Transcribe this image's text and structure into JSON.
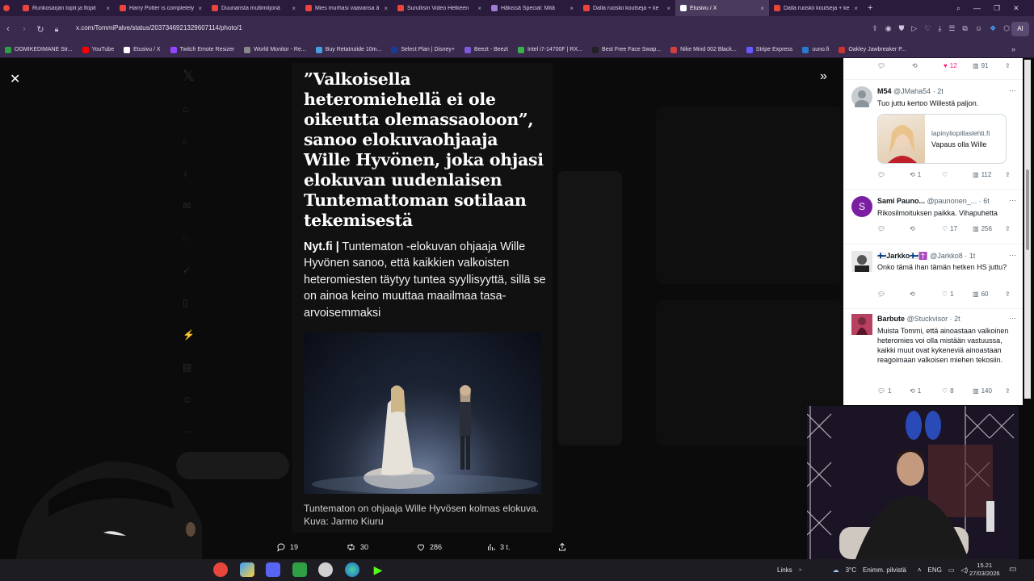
{
  "browser": {
    "tabs": [
      {
        "label": "Runkosarjan topit ja flopit",
        "color": "#e8453c",
        "active": false
      },
      {
        "label": "Harry Potter is completely",
        "color": "#e8453c",
        "active": false
      },
      {
        "label": "Duunarista multimiljonä",
        "color": "#e8453c",
        "active": false
      },
      {
        "label": "Mies murhasi vaavansa ä",
        "color": "#e8453c",
        "active": false
      },
      {
        "label": "Surullisin Video Hetkeen",
        "color": "#e8453c",
        "active": false
      },
      {
        "label": "Häkissä Special: Mitä",
        "color": "#a07ad8",
        "active": false
      },
      {
        "label": "Dalla ruoskii koutseja + ke",
        "color": "#e8453c",
        "active": false
      },
      {
        "label": "Etusivu / X",
        "color": "#ffffff",
        "active": true
      },
      {
        "label": "Dalla ruoskii koutseja + ke",
        "color": "#e8453c",
        "active": false
      }
    ],
    "new_tab": "+",
    "url": "x.com/TommiPalve/status/2037346921329607114/photo/1",
    "ai_label": "AI",
    "bookmarks": [
      {
        "label": "OGMIKEDIMANE Str...",
        "color": "#2ea043"
      },
      {
        "label": "YouTube",
        "color": "#ff0000"
      },
      {
        "label": "Etusivu / X",
        "color": "#ffffff"
      },
      {
        "label": "Twitch Emote Resizer",
        "color": "#9146ff"
      },
      {
        "label": "World Monitor - Re...",
        "color": "#888888"
      },
      {
        "label": "Buy Retatrutide 10m...",
        "color": "#46a0e0"
      },
      {
        "label": "Select Plan | Disney+",
        "color": "#1a3a9a"
      },
      {
        "label": "Beezt - Beezt",
        "color": "#7d5ad8"
      },
      {
        "label": "Intel i7-14700F | RX...",
        "color": "#3ab04a"
      },
      {
        "label": "Best Free Face Swap...",
        "color": "#222222"
      },
      {
        "label": "Nike Mind 002 Black...",
        "color": "#d04040"
      },
      {
        "label": "Stripe Express",
        "color": "#635bff"
      },
      {
        "label": "uuno.fi",
        "color": "#2a7ad0"
      },
      {
        "label": "Oakley Jawbreaker P...",
        "color": "#cc3333"
      }
    ]
  },
  "article": {
    "headline": "”Valkoisella heteromiehellä ei ole oikeutta olemassaoloon”, sanoo elokuvaohjaaja Wille Hyvönen, joka ohjasi elokuvan uudenlaisen Tuntemattoman sotilaan tekemisestä",
    "source": "Nyt.fi |",
    "lede": " Tuntematon -elokuvan ohjaaja Wille Hyvönen sanoo, että kaikkien valkoisten heteromiesten täytyy tuntea syyllisyyttä, sillä se on ainoa keino muuttaa maailmaa tasa-arvoisemmaksi",
    "caption": "Tuntematon on ohjaaja Wille Hyvösen kolmas elokuva. Kuva: Jarmo Kiuru"
  },
  "post_actions": {
    "replies": "19",
    "reposts": "30",
    "likes": "286",
    "views": "3 t."
  },
  "replies_panel": {
    "top_stats": {
      "likes": "12",
      "views": "91"
    },
    "replies": [
      {
        "name": "M54",
        "handle": "@JMaha54 · 2t",
        "text": "Tuo juttu kertoo Willestä paljon.",
        "card": {
          "domain": "lapinyliopillaslehti.fi",
          "title": "Vapaus olla Wille"
        },
        "stats": {
          "replies": "",
          "reposts": "1",
          "likes": "",
          "views": "112"
        },
        "avatar_color": "#9aa4ad"
      },
      {
        "name": "Sami Pauno...",
        "handle": "@paunonen_... · 6t",
        "text": "Rikosilmoituksen paikka. Vihapuhetta",
        "stats": {
          "replies": "",
          "reposts": "",
          "likes": "17",
          "views": "256"
        },
        "avatar_letter": "S",
        "avatar_color": "#7b1fa2"
      },
      {
        "name": "🇫🇮Jarkko🇫🇮✝️",
        "handle": "@Jarkko8 · 1t",
        "text": "Onko tämä ihan tämän hetken HS juttu?",
        "stats": {
          "replies": "",
          "reposts": "",
          "likes": "1",
          "views": "60"
        },
        "avatar_color": "#4a4a4a"
      },
      {
        "name": "Barbute",
        "handle": "@Stuckvisor · 2t",
        "text": "Muista Tommi, että ainoastaan valkoinen heteromies voi olla mistään vastuussa, kaikki muut ovat kykeneviä ainoastaan reagoimaan valkoisen miehen tekosiin.",
        "stats": {
          "replies": "1",
          "reposts": "1",
          "likes": "8",
          "views": "140"
        },
        "avatar_color": "#a03050"
      }
    ]
  },
  "taskbar": {
    "links": "Links",
    "weather_temp": "3°C",
    "weather_text": "Enimm. pilvistä",
    "lang": "ENG",
    "time": "15.21",
    "date": "27/03/2026"
  },
  "icons": {
    "close": "close-icon",
    "next": "chevron-right-icon",
    "reply": "reply-icon",
    "repost": "repost-icon",
    "like": "heart-icon",
    "views": "bar-chart-icon",
    "share": "share-icon"
  },
  "colors": {
    "x_dark_bg": "#0a0a0a",
    "browser_purple": "#3a2a4e",
    "like_pink": "#f91880"
  }
}
